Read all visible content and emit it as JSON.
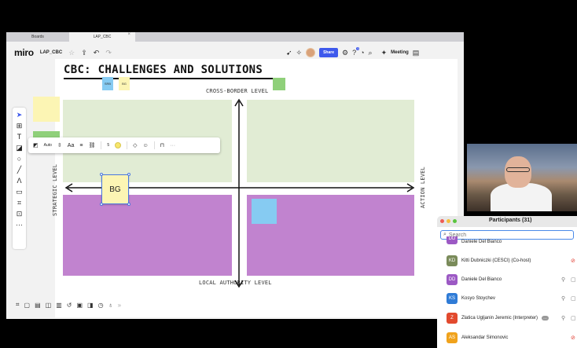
{
  "browser": {
    "tabs": [
      {
        "label": "Boards"
      },
      {
        "label": "LAP_CBC",
        "close": "×"
      }
    ]
  },
  "miro": {
    "logo": "miro",
    "board_name": "LAP_CBC",
    "share_label": "Share",
    "notification_count": "1",
    "meeting_label": "Meeting"
  },
  "board": {
    "title": "CBC: CHALLENGES AND SOLUTIONS",
    "top_axis": "CROSS-BORDER LEVEL",
    "bottom_axis": "LOCAL AUTHORITY LEVEL",
    "left_axis": "STRATEGIC LEVEL",
    "right_axis": "ACTION LEVEL",
    "stickies": {
      "srb": "SRB",
      "bg_small": "BG",
      "bg_selected": "BG"
    },
    "colors": {
      "green_quadrant": "#e1ecd4",
      "purple_quadrant": "#c183cf",
      "sticky_yellow": "#fcf5b4",
      "sticky_blue": "#86cbf2",
      "sticky_green": "#8fd07a"
    }
  },
  "context_toolbar": {
    "size_mode": "Auto",
    "font_label": "Aa",
    "font_size": "5"
  },
  "participants": {
    "title": "Participants (31)",
    "search_placeholder": "Search",
    "rows": [
      {
        "name": "Daniele Del Bianco",
        "initials": "DD",
        "color": "#9c59c4",
        "partial": true
      },
      {
        "name": "Kitti Dubniczki (CESCI) (Co-host)",
        "initials": "KD",
        "color": "#7a8b5a"
      },
      {
        "name": "Daniele Del Bianco",
        "initials": "DD",
        "color": "#9c59c4"
      },
      {
        "name": "Kosyo Stoychev",
        "initials": "KS",
        "color": "#2f7bd6"
      },
      {
        "name": "Zlatica Ugljanin Jeremic (Interpreter)",
        "initials": "Z",
        "color": "#e24a2e",
        "tag": "…"
      },
      {
        "name": "Aleksandar Simonovic",
        "initials": "AS",
        "color": "#f0a21c"
      }
    ]
  }
}
